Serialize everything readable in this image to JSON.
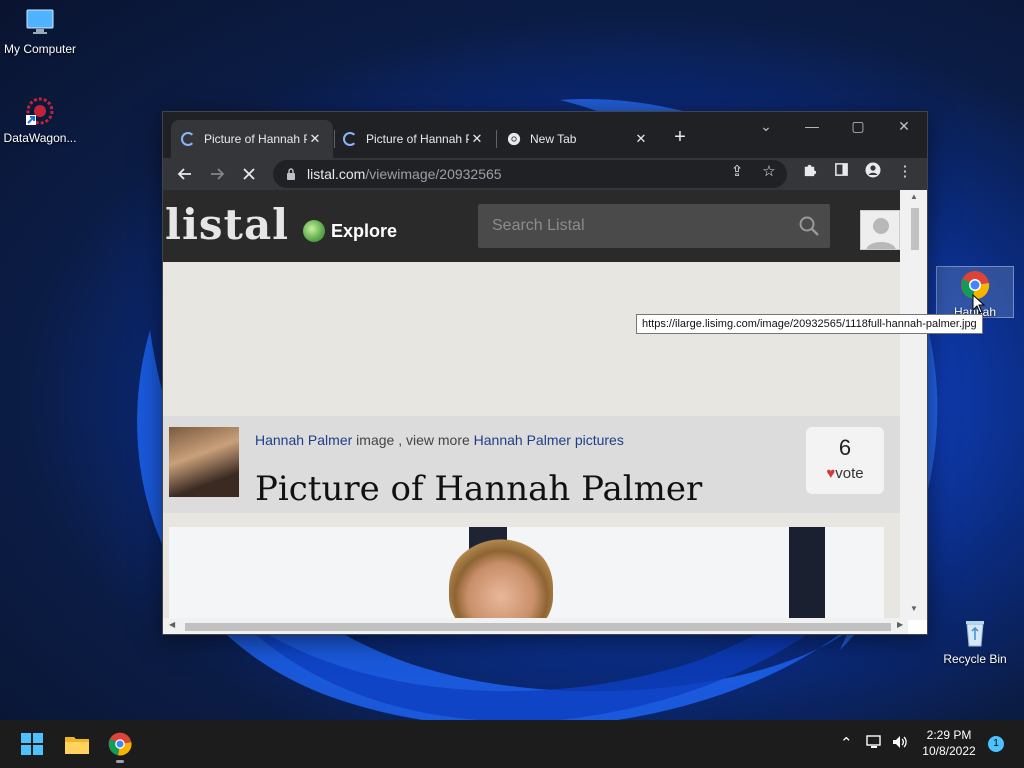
{
  "desktop": {
    "icons": [
      {
        "label": "My Computer"
      },
      {
        "label": "DataWagon..."
      },
      {
        "label": "Hannah"
      },
      {
        "label": "Recycle Bin"
      }
    ]
  },
  "browser": {
    "tabs": [
      {
        "title": "Picture of Hannah Palmer",
        "loading": true
      },
      {
        "title": "Picture of Hannah Palmer",
        "loading": true
      },
      {
        "title": "New Tab",
        "loading": false
      }
    ],
    "url_host": "listal.com",
    "url_path": "/viewimage/20932565",
    "tooltip": "https://ilarge.lisimg.com/image/20932565/1118full-hannah-palmer.jpg"
  },
  "page": {
    "logo": "listal",
    "explore_label": "Explore",
    "search_placeholder": "Search Listal",
    "person_name": "Hannah Palmer",
    "info_middle": " image , view more ",
    "pictures_link": "Hannah Palmer pictures",
    "title": "Picture of Hannah Palmer",
    "vote_count": "6",
    "vote_label": "vote"
  },
  "taskbar": {
    "time": "2:29 PM",
    "date": "10/8/2022",
    "notifications": "1"
  },
  "colors": {
    "accent": "#8ab4f8",
    "link": "#1f3e88",
    "heart": "#d23b3b"
  }
}
